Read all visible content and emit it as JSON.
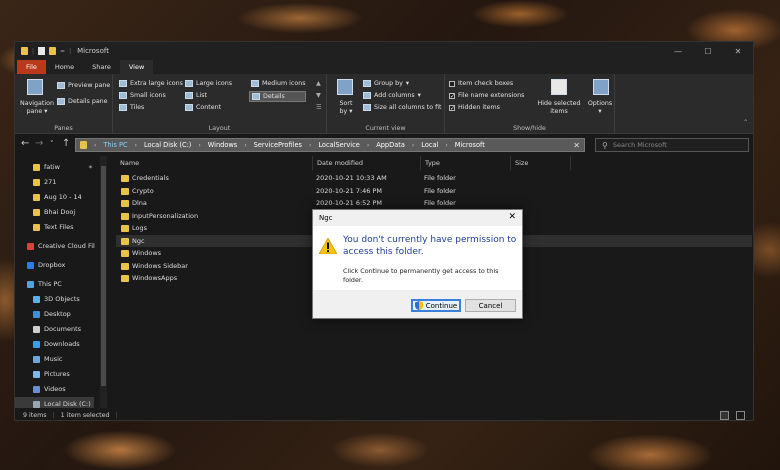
{
  "window": {
    "title": "Microsoft"
  },
  "tabs": [
    "File",
    "Home",
    "Share",
    "View"
  ],
  "ribbon": {
    "panes_group": {
      "label": "Panes",
      "navigation_pane": "Navigation pane",
      "preview_pane": "Preview pane",
      "details_pane": "Details pane"
    },
    "layout_group": {
      "label": "Layout",
      "items": [
        "Extra large icons",
        "Large icons",
        "Medium icons",
        "Small icons",
        "List",
        "Details",
        "Tiles",
        "Content"
      ]
    },
    "current_view_group": {
      "label": "Current view",
      "sort_by": "Sort by",
      "group_by": "Group by",
      "add_columns": "Add columns",
      "size_all_columns": "Size all columns to fit"
    },
    "show_hide_group": {
      "label": "Show/hide",
      "item_check_boxes": "Item check boxes",
      "file_name_extensions": "File name extensions",
      "hidden_items": "Hidden items",
      "hide_selected": "Hide selected items",
      "options": "Options",
      "item_check_boxes_checked": false,
      "file_name_extensions_checked": true,
      "hidden_items_checked": true
    }
  },
  "address": {
    "segments": [
      "This PC",
      "Local Disk (C:)",
      "Windows",
      "ServiceProfiles",
      "LocalService",
      "AppData",
      "Local",
      "Microsoft"
    ],
    "search_placeholder": "Search Microsoft"
  },
  "nav_pane": {
    "items": [
      {
        "label": "fatiw",
        "icon": "folder-icon",
        "pinned": true
      },
      {
        "label": "271",
        "icon": "folder-icon"
      },
      {
        "label": "Aug 10 - 14",
        "icon": "folder-icon"
      },
      {
        "label": "Bhai Dooj",
        "icon": "folder-icon"
      },
      {
        "label": "Text Files",
        "icon": "folder-icon"
      },
      {
        "label": "Creative Cloud Fil",
        "icon": "creative-cloud-icon"
      },
      {
        "label": "Dropbox",
        "icon": "dropbox-icon"
      },
      {
        "label": "This PC",
        "icon": "computer-icon"
      },
      {
        "label": "3D Objects",
        "icon": "cube-icon"
      },
      {
        "label": "Desktop",
        "icon": "desktop-icon"
      },
      {
        "label": "Documents",
        "icon": "documents-icon"
      },
      {
        "label": "Downloads",
        "icon": "downloads-icon"
      },
      {
        "label": "Music",
        "icon": "music-icon"
      },
      {
        "label": "Pictures",
        "icon": "pictures-icon"
      },
      {
        "label": "Videos",
        "icon": "videos-icon"
      },
      {
        "label": "Local Disk (C:)",
        "icon": "drive-icon",
        "selected": true
      },
      {
        "label": "New Volume (D:",
        "icon": "drive-icon"
      }
    ]
  },
  "file_list": {
    "columns": [
      "Name",
      "Date modified",
      "Type",
      "Size"
    ],
    "rows": [
      {
        "name": "Credentials",
        "date": "2020-10-21 10:33 AM",
        "type": "File folder"
      },
      {
        "name": "Crypto",
        "date": "2020-10-21 7:46 PM",
        "type": "File folder"
      },
      {
        "name": "Dlna",
        "date": "2020-10-21 6:52 PM",
        "type": "File folder"
      },
      {
        "name": "InputPersonalization",
        "date": "",
        "type": ""
      },
      {
        "name": "Logs",
        "date": "",
        "type": ""
      },
      {
        "name": "Ngc",
        "date": "",
        "type": "",
        "selected": true
      },
      {
        "name": "Windows",
        "date": "",
        "type": ""
      },
      {
        "name": "Windows Sidebar",
        "date": "",
        "type": ""
      },
      {
        "name": "WindowsApps",
        "date": "",
        "type": ""
      }
    ]
  },
  "status_bar": {
    "item_count": "9 items",
    "selected": "1 item selected"
  },
  "dialog": {
    "title": "Ngc",
    "main_instruction": "You don't currently have permission to access this folder.",
    "content": "Click Continue to permanently get access to this folder.",
    "continue_label": "Continue",
    "cancel_label": "Cancel"
  }
}
